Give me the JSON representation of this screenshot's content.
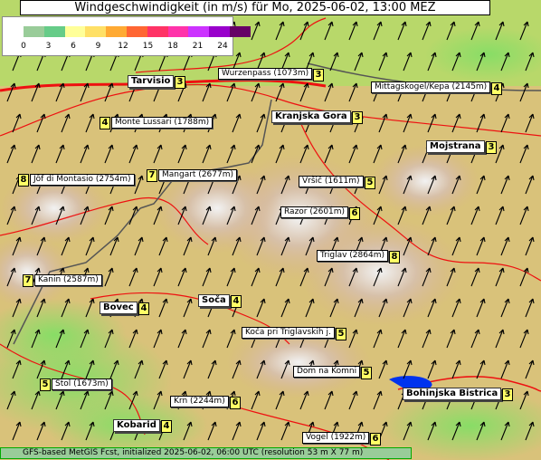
{
  "title": "Windgeschwindigkeit (in m/s) für Mo, 2025-06-02, 13:00 MEZ",
  "legend": {
    "ticks": [
      "0",
      "3",
      "6",
      "9",
      "12",
      "15",
      "18",
      "21",
      "24"
    ],
    "colors": [
      "#99cc99",
      "#66cc88",
      "#ffff99",
      "#ffe066",
      "#ffaa33",
      "#ff6633",
      "#ff3366",
      "#ff33aa",
      "#cc33ff",
      "#9900cc",
      "#660066"
    ]
  },
  "places": [
    {
      "name": "Tarvisio",
      "value": "3",
      "type": "town"
    },
    {
      "name": "Wurzenpass (1073m)",
      "value": "3",
      "type": "peak"
    },
    {
      "name": "Mittagskogel/Kepa (2145m)",
      "value": "4",
      "type": "peak"
    },
    {
      "name": "Monte Lussari (1788m)",
      "value": "4",
      "type": "peak"
    },
    {
      "name": "Kranjska Gora",
      "value": "3",
      "type": "town"
    },
    {
      "name": "Mojstrana",
      "value": "3",
      "type": "town"
    },
    {
      "name": "Jôf di Montasio (2754m)",
      "value": "8",
      "type": "peak"
    },
    {
      "name": "Mangart (2677m)",
      "value": "7",
      "type": "peak"
    },
    {
      "name": "Vršič (1611m)",
      "value": "5",
      "type": "peak"
    },
    {
      "name": "Razor (2601m)",
      "value": "6",
      "type": "peak"
    },
    {
      "name": "Triglav (2864m)",
      "value": "8",
      "type": "peak"
    },
    {
      "name": "Kanin (2587m)",
      "value": "7",
      "type": "peak"
    },
    {
      "name": "Bovec",
      "value": "4",
      "type": "town"
    },
    {
      "name": "Soča",
      "value": "4",
      "type": "town"
    },
    {
      "name": "Koča pri Triglavskih j.",
      "value": "5",
      "type": "peak"
    },
    {
      "name": "Dom na Komni",
      "value": "5",
      "type": "peak"
    },
    {
      "name": "Stol (1673m)",
      "value": "5",
      "type": "peak"
    },
    {
      "name": "Bohinjska Bistrica",
      "value": "3",
      "type": "town"
    },
    {
      "name": "Krn (2244m)",
      "value": "6",
      "type": "peak"
    },
    {
      "name": "Kobarid",
      "value": "4",
      "type": "town"
    },
    {
      "name": "Vogel (1922m)",
      "value": "6",
      "type": "peak"
    }
  ],
  "footer": "GFS-based MetGIS Fcst, initialized 2025-06-02, 06:00 UTC  (resolution 53 m X 77 m)",
  "colors": {
    "lake": "#0033ee",
    "road": "#ee1111",
    "border": "#555555",
    "arrow": "#000000"
  }
}
